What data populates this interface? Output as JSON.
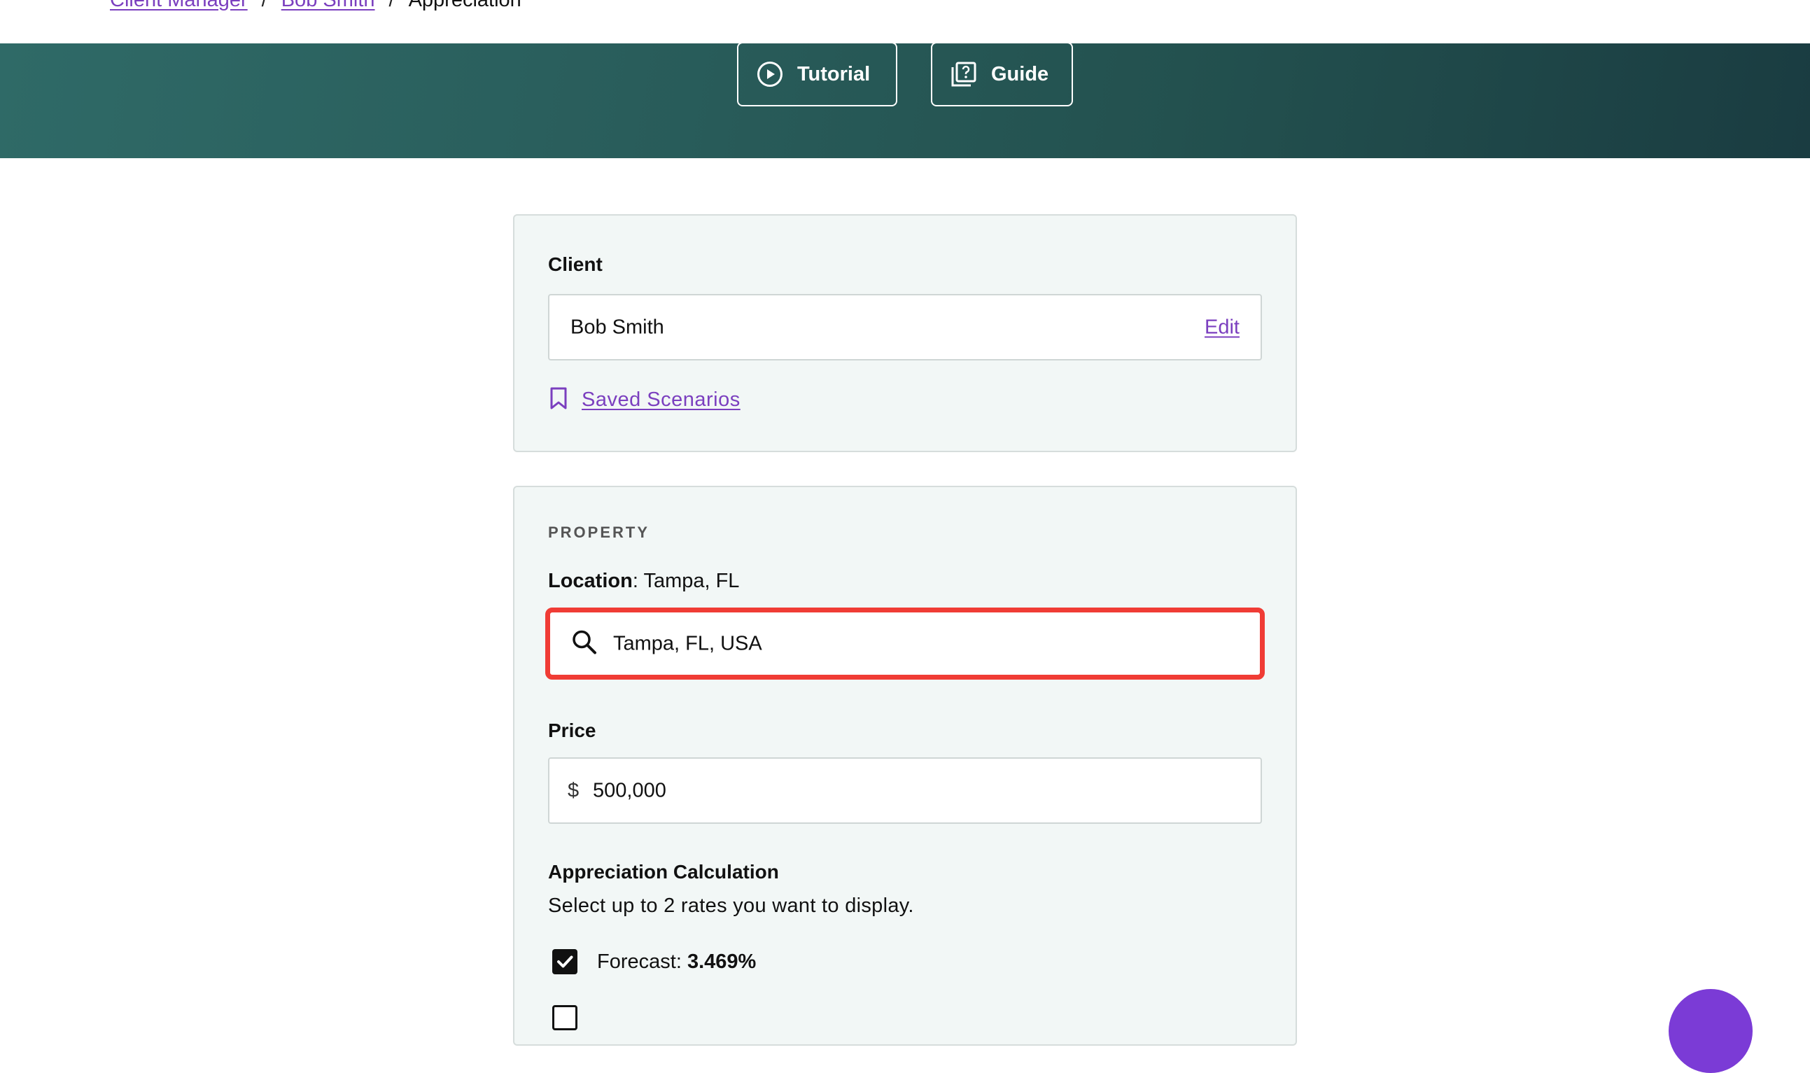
{
  "breadcrumb": {
    "items": [
      {
        "label": "Client Manager"
      },
      {
        "label": "Bob Smith"
      }
    ],
    "separator": "/",
    "current": "Appreciation"
  },
  "hero": {
    "tutorial_label": "Tutorial",
    "guide_label": "Guide"
  },
  "client": {
    "label": "Client",
    "name": "Bob Smith",
    "edit_label": "Edit",
    "saved_scenarios_label": "Saved Scenarios"
  },
  "property": {
    "section_title": "PROPERTY",
    "location_label": "Location",
    "location_colon": ":",
    "location_value": " Tampa, FL",
    "search_value": "Tampa, FL, USA",
    "price_label": "Price",
    "currency_symbol": "$",
    "price_value": "500,000",
    "calc_title": "Appreciation Calculation",
    "calc_subtitle": "Select up to 2 rates you want to display.",
    "rates": [
      {
        "label": "Forecast: ",
        "value": "3.469%",
        "checked": true
      },
      {
        "label": "",
        "value": "",
        "checked": false
      }
    ]
  },
  "colors": {
    "accent_link": "#7b3fbf",
    "hero_start": "#2f6a67",
    "hero_end": "#1a3c41",
    "highlight_border": "#f03c35",
    "fab": "#7b3bd6"
  }
}
